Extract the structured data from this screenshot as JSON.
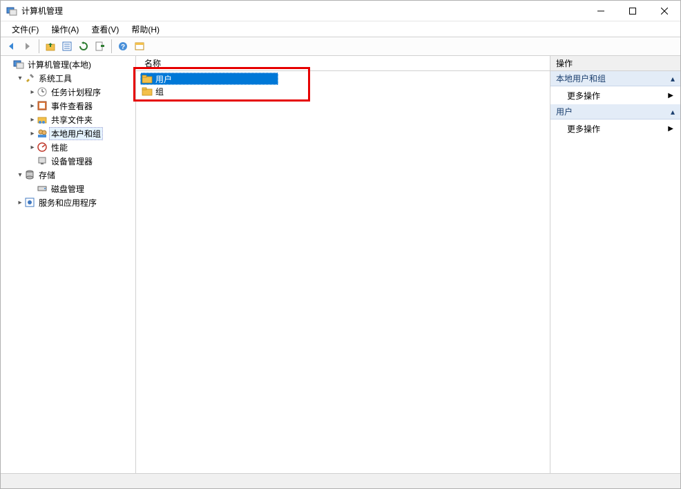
{
  "window": {
    "title": "计算机管理"
  },
  "menu": {
    "file": "文件(F)",
    "action": "操作(A)",
    "view": "查看(V)",
    "help": "帮助(H)"
  },
  "tree": {
    "root": "计算机管理(本地)",
    "system_tools": "系统工具",
    "task_scheduler": "任务计划程序",
    "event_viewer": "事件查看器",
    "shared_folders": "共享文件夹",
    "local_users_groups": "本地用户和组",
    "performance": "性能",
    "device_manager": "设备管理器",
    "storage": "存储",
    "disk_management": "磁盘管理",
    "services_apps": "服务和应用程序"
  },
  "list": {
    "header_name": "名称",
    "items": [
      {
        "label": "用户"
      },
      {
        "label": "组"
      }
    ]
  },
  "actions": {
    "title": "操作",
    "section1": "本地用户和组",
    "more_actions": "更多操作",
    "section2": "用户"
  }
}
